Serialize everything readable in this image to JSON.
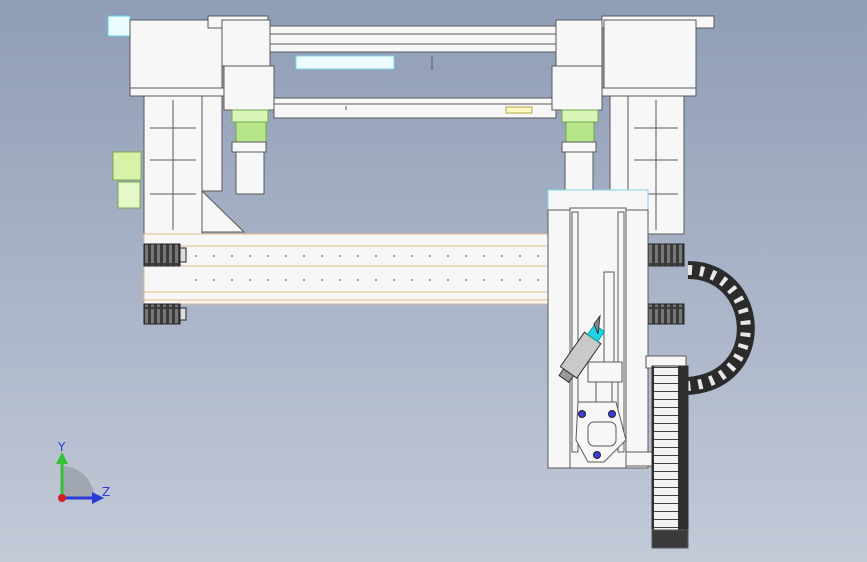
{
  "viewport": {
    "background_top": "#8f9db6",
    "background_bottom": "#c3cad8"
  },
  "model": {
    "line_color": "#5a5a5a",
    "face_color": "#f7f7f7",
    "accent_green": "#b7e68a",
    "accent_cyan": "#22d3e6",
    "accent_orange": "#e8b98a",
    "chain_color": "#2b2b2b"
  },
  "triad": {
    "y_label": "Y",
    "z_label": "Z",
    "y_color": "#35c135",
    "z_color": "#2a3bd6",
    "x_color": "#d02020",
    "icon": "coordinate-triad-icon"
  }
}
